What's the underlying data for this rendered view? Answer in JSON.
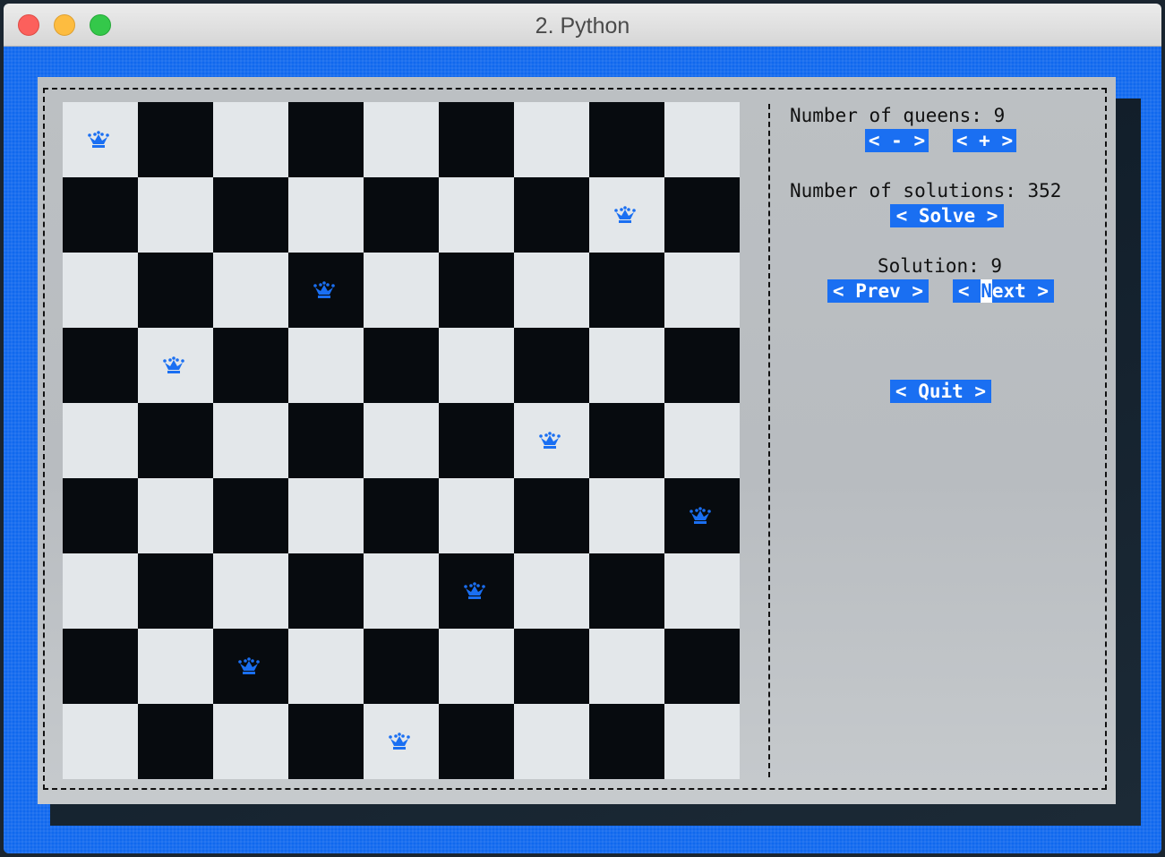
{
  "window": {
    "title": "2. Python"
  },
  "panel": {
    "queens_label": "Number of queens: 9",
    "decrease_label": "< - >",
    "increase_label": "< + >",
    "solutions_label": "Number of solutions: 352",
    "solve_label": "< Solve >",
    "solution_label": "Solution: 9",
    "prev_label": "< Prev >",
    "next_prefix": "< ",
    "next_cursor": "N",
    "next_suffix": "ext >",
    "quit_label": "< Quit >"
  },
  "board": {
    "size": 9,
    "queen_positions": [
      {
        "row": 1,
        "col": 1
      },
      {
        "row": 2,
        "col": 8
      },
      {
        "row": 3,
        "col": 4
      },
      {
        "row": 4,
        "col": 2
      },
      {
        "row": 5,
        "col": 7
      },
      {
        "row": 6,
        "col": 9
      },
      {
        "row": 7,
        "col": 6
      },
      {
        "row": 8,
        "col": 3
      },
      {
        "row": 9,
        "col": 5
      }
    ],
    "queen_icon": "queen-icon",
    "queen_color": "#1a6ff2",
    "light_color": "#e3e7ea",
    "dark_color": "#070b0f"
  },
  "colors": {
    "accent": "#1a6ff2",
    "button_text": "#ffffff"
  }
}
